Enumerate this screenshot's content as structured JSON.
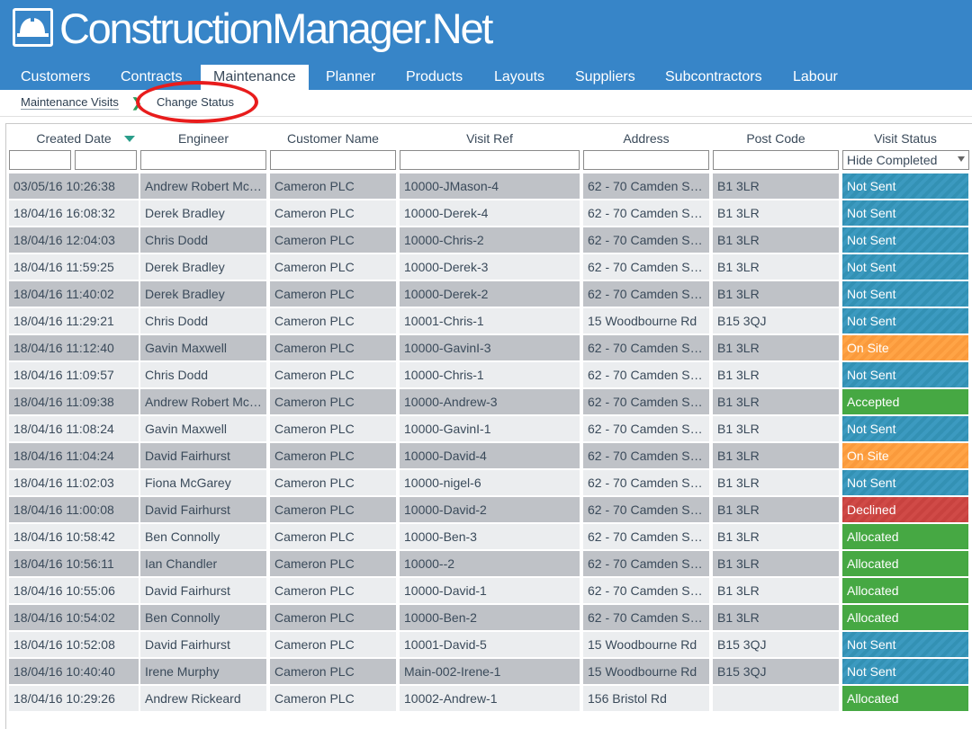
{
  "app": {
    "title": "ConstructionManager.Net"
  },
  "nav": {
    "items": [
      {
        "label": "Customers"
      },
      {
        "label": "Contracts"
      },
      {
        "label": "Maintenance",
        "active": true
      },
      {
        "label": "Planner"
      },
      {
        "label": "Products"
      },
      {
        "label": "Layouts"
      },
      {
        "label": "Suppliers"
      },
      {
        "label": "Subcontractors"
      },
      {
        "label": "Labour"
      }
    ]
  },
  "breadcrumb": {
    "parent": "Maintenance Visits",
    "current": "Change Status"
  },
  "table": {
    "columns": {
      "created": "Created Date",
      "engineer": "Engineer",
      "customer": "Customer Name",
      "ref": "Visit Ref",
      "address": "Address",
      "postcode": "Post Code",
      "status": "Visit Status"
    },
    "status_filter": "Hide Completed",
    "rows": [
      {
        "created": "03/05/16 10:26:38",
        "engineer": "Andrew Robert Mc…",
        "customer": "Cameron PLC",
        "ref": "10000-JMason-4",
        "address": "62 - 70 Camden S…",
        "postcode": "B1 3LR",
        "status": "Not Sent"
      },
      {
        "created": "18/04/16 16:08:32",
        "engineer": "Derek Bradley",
        "customer": "Cameron PLC",
        "ref": "10000-Derek-4",
        "address": "62 - 70 Camden S…",
        "postcode": "B1 3LR",
        "status": "Not Sent"
      },
      {
        "created": "18/04/16 12:04:03",
        "engineer": "Chris Dodd",
        "customer": "Cameron PLC",
        "ref": "10000-Chris-2",
        "address": "62 - 70 Camden S…",
        "postcode": "B1 3LR",
        "status": "Not Sent"
      },
      {
        "created": "18/04/16 11:59:25",
        "engineer": "Derek Bradley",
        "customer": "Cameron PLC",
        "ref": "10000-Derek-3",
        "address": "62 - 70 Camden S…",
        "postcode": "B1 3LR",
        "status": "Not Sent"
      },
      {
        "created": "18/04/16 11:40:02",
        "engineer": "Derek Bradley",
        "customer": "Cameron PLC",
        "ref": "10000-Derek-2",
        "address": "62 - 70 Camden S…",
        "postcode": "B1 3LR",
        "status": "Not Sent"
      },
      {
        "created": "18/04/16 11:29:21",
        "engineer": "Chris Dodd",
        "customer": "Cameron PLC",
        "ref": "10001-Chris-1",
        "address": "15 Woodbourne Rd",
        "postcode": "B15 3QJ",
        "status": "Not Sent"
      },
      {
        "created": "18/04/16 11:12:40",
        "engineer": "Gavin Maxwell",
        "customer": "Cameron PLC",
        "ref": "10000-GavinI-3",
        "address": "62 - 70 Camden S…",
        "postcode": "B1 3LR",
        "status": "On Site"
      },
      {
        "created": "18/04/16 11:09:57",
        "engineer": "Chris Dodd",
        "customer": "Cameron PLC",
        "ref": "10000-Chris-1",
        "address": "62 - 70 Camden S…",
        "postcode": "B1 3LR",
        "status": "Not Sent"
      },
      {
        "created": "18/04/16 11:09:38",
        "engineer": "Andrew Robert Mc…",
        "customer": "Cameron PLC",
        "ref": "10000-Andrew-3",
        "address": "62 - 70 Camden S…",
        "postcode": "B1 3LR",
        "status": "Accepted"
      },
      {
        "created": "18/04/16 11:08:24",
        "engineer": "Gavin Maxwell",
        "customer": "Cameron PLC",
        "ref": "10000-GavinI-1",
        "address": "62 - 70 Camden S…",
        "postcode": "B1 3LR",
        "status": "Not Sent"
      },
      {
        "created": "18/04/16 11:04:24",
        "engineer": "David Fairhurst",
        "customer": "Cameron PLC",
        "ref": "10000-David-4",
        "address": "62 - 70 Camden S…",
        "postcode": "B1 3LR",
        "status": "On Site"
      },
      {
        "created": "18/04/16 11:02:03",
        "engineer": "Fiona McGarey",
        "customer": "Cameron PLC",
        "ref": "10000-nigel-6",
        "address": "62 - 70 Camden S…",
        "postcode": "B1 3LR",
        "status": "Not Sent"
      },
      {
        "created": "18/04/16 11:00:08",
        "engineer": "David Fairhurst",
        "customer": "Cameron PLC",
        "ref": "10000-David-2",
        "address": "62 - 70 Camden S…",
        "postcode": "B1 3LR",
        "status": "Declined"
      },
      {
        "created": "18/04/16 10:58:42",
        "engineer": "Ben Connolly",
        "customer": "Cameron PLC",
        "ref": "10000-Ben-3",
        "address": "62 - 70 Camden S…",
        "postcode": "B1 3LR",
        "status": "Allocated"
      },
      {
        "created": "18/04/16 10:56:11",
        "engineer": "Ian Chandler",
        "customer": "Cameron PLC",
        "ref": "10000--2",
        "address": "62 - 70 Camden S…",
        "postcode": "B1 3LR",
        "status": "Allocated"
      },
      {
        "created": "18/04/16 10:55:06",
        "engineer": "David Fairhurst",
        "customer": "Cameron PLC",
        "ref": "10000-David-1",
        "address": "62 - 70 Camden S…",
        "postcode": "B1 3LR",
        "status": "Allocated"
      },
      {
        "created": "18/04/16 10:54:02",
        "engineer": "Ben Connolly",
        "customer": "Cameron PLC",
        "ref": "10000-Ben-2",
        "address": "62 - 70 Camden S…",
        "postcode": "B1 3LR",
        "status": "Allocated"
      },
      {
        "created": "18/04/16 10:52:08",
        "engineer": "David Fairhurst",
        "customer": "Cameron PLC",
        "ref": "10001-David-5",
        "address": "15 Woodbourne Rd",
        "postcode": "B15 3QJ",
        "status": "Not Sent"
      },
      {
        "created": "18/04/16 10:40:40",
        "engineer": "Irene Murphy",
        "customer": "Cameron PLC",
        "ref": "Main-002-Irene-1",
        "address": "15 Woodbourne Rd",
        "postcode": "B15 3QJ",
        "status": "Not Sent"
      },
      {
        "created": "18/04/16 10:29:26",
        "engineer": "Andrew Rickeard",
        "customer": "Cameron PLC",
        "ref": "10002-Andrew-1",
        "address": "156 Bristol Rd",
        "postcode": "",
        "status": "Allocated"
      }
    ]
  },
  "colors": {
    "brand": "#3785c8",
    "not_sent": "#3391b4",
    "on_site": "#fa9a3c",
    "accepted": "#46a843",
    "allocated": "#46a843",
    "declined": "#c8423f",
    "annotation": "#e81c1c"
  }
}
